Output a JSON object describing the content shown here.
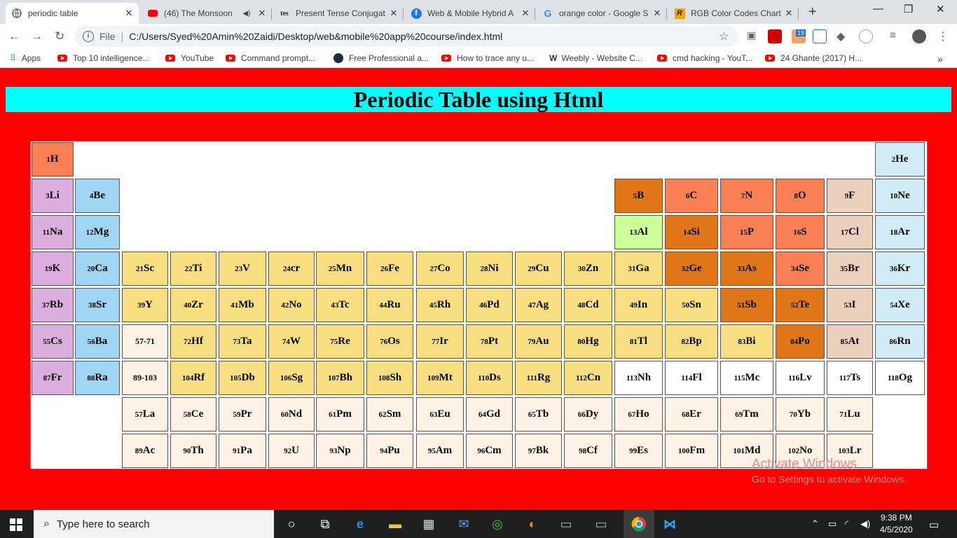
{
  "browser": {
    "tabs": [
      {
        "title": "periodic table",
        "icon": "globe-icon",
        "active": true
      },
      {
        "title": "(46) The Monsoon",
        "icon": "youtube-icon",
        "active": false
      },
      {
        "title": "Present Tense Conjugat",
        "icon": "tes-icon",
        "active": false
      },
      {
        "title": "Web & Mobile Hybrid A",
        "icon": "facebook-icon",
        "active": false
      },
      {
        "title": "orange color - Google S",
        "icon": "google-icon",
        "active": false
      },
      {
        "title": "RGB Color Codes Chart",
        "icon": "rgb-icon",
        "active": false
      }
    ],
    "close_glyph": "✕",
    "new_tab": "+",
    "address": {
      "scheme_label": "File",
      "url": "C:/Users/Syed%20Amin%20Zaidi/Desktop/web&mobile%20app%20course/index.html"
    },
    "bookmarks": [
      {
        "label": "Apps",
        "icon": "apps-grid-icon"
      },
      {
        "label": "Top 10 intelligence...",
        "icon": "youtube-icon"
      },
      {
        "label": "YouTube",
        "icon": "youtube-icon"
      },
      {
        "label": "Command prompt...",
        "icon": "youtube-icon"
      },
      {
        "label": "Free Professional a...",
        "icon": "logo-icon"
      },
      {
        "label": "How to trace any u...",
        "icon": "youtube-icon"
      },
      {
        "label": "Weebly - Website C...",
        "icon": "weebly-icon"
      },
      {
        "label": "cmd hacking - YouT...",
        "icon": "youtube-icon"
      },
      {
        "label": "24 Ghante (2017) H...",
        "icon": "youtube-icon"
      }
    ],
    "bookmarks_more": "»",
    "ext_badge": "19"
  },
  "page": {
    "title": "Periodic Table using Html",
    "colors": {
      "background": "#ff0000",
      "header": "#00ffff",
      "alkali": "#dcaddf",
      "alkaline": "#9fd4f2",
      "transition": "#f7df81",
      "post_transition": "#f7df81",
      "metalloid": "#df7718",
      "nonmetal": "#fa7f55",
      "halogen": "#ebd1bd",
      "noble": "#d1ecf7",
      "lanthanide": "#fdf2e6",
      "unknown": "#ffffff",
      "aluminum": "#ccff99"
    },
    "elements": [
      {
        "n": "1",
        "s": "H",
        "r": 1,
        "c": 1,
        "g": "nonmetal"
      },
      {
        "n": "2",
        "s": "He",
        "r": 1,
        "c": 18,
        "g": "noble"
      },
      {
        "n": "3",
        "s": "Li",
        "r": 2,
        "c": 1,
        "g": "alkali"
      },
      {
        "n": "4",
        "s": "Be",
        "r": 2,
        "c": 2,
        "g": "alkaline"
      },
      {
        "n": "5",
        "s": "B",
        "r": 2,
        "c": 13,
        "g": "metalloid"
      },
      {
        "n": "6",
        "s": "C",
        "r": 2,
        "c": 14,
        "g": "nonmetal"
      },
      {
        "n": "7",
        "s": "N",
        "r": 2,
        "c": 15,
        "g": "nonmetal"
      },
      {
        "n": "8",
        "s": "O",
        "r": 2,
        "c": 16,
        "g": "nonmetal"
      },
      {
        "n": "9",
        "s": "F",
        "r": 2,
        "c": 17,
        "g": "halogen"
      },
      {
        "n": "10",
        "s": "Ne",
        "r": 2,
        "c": 18,
        "g": "noble"
      },
      {
        "n": "11",
        "s": "Na",
        "r": 3,
        "c": 1,
        "g": "alkali"
      },
      {
        "n": "12",
        "s": "Mg",
        "r": 3,
        "c": 2,
        "g": "alkaline"
      },
      {
        "n": "13",
        "s": "Al",
        "r": 3,
        "c": 13,
        "g": "aluminum"
      },
      {
        "n": "14",
        "s": "Si",
        "r": 3,
        "c": 14,
        "g": "metalloid"
      },
      {
        "n": "15",
        "s": "P",
        "r": 3,
        "c": 15,
        "g": "nonmetal"
      },
      {
        "n": "16",
        "s": "S",
        "r": 3,
        "c": 16,
        "g": "nonmetal"
      },
      {
        "n": "17",
        "s": "Cl",
        "r": 3,
        "c": 17,
        "g": "halogen"
      },
      {
        "n": "18",
        "s": "Ar",
        "r": 3,
        "c": 18,
        "g": "noble"
      },
      {
        "n": "19",
        "s": "K",
        "r": 4,
        "c": 1,
        "g": "alkali"
      },
      {
        "n": "20",
        "s": "Ca",
        "r": 4,
        "c": 2,
        "g": "alkaline"
      },
      {
        "n": "21",
        "s": "Sc",
        "r": 4,
        "c": 3,
        "g": "transition"
      },
      {
        "n": "22",
        "s": "Ti",
        "r": 4,
        "c": 4,
        "g": "transition"
      },
      {
        "n": "23",
        "s": "V",
        "r": 4,
        "c": 5,
        "g": "transition"
      },
      {
        "n": "24",
        "s": "cr",
        "r": 4,
        "c": 6,
        "g": "transition"
      },
      {
        "n": "25",
        "s": "Mn",
        "r": 4,
        "c": 7,
        "g": "transition"
      },
      {
        "n": "26",
        "s": "Fe",
        "r": 4,
        "c": 8,
        "g": "transition"
      },
      {
        "n": "27",
        "s": "Co",
        "r": 4,
        "c": 9,
        "g": "transition"
      },
      {
        "n": "28",
        "s": "Ni",
        "r": 4,
        "c": 10,
        "g": "transition"
      },
      {
        "n": "29",
        "s": "Cu",
        "r": 4,
        "c": 11,
        "g": "transition"
      },
      {
        "n": "30",
        "s": "Zn",
        "r": 4,
        "c": 12,
        "g": "transition"
      },
      {
        "n": "31",
        "s": "Ga",
        "r": 4,
        "c": 13,
        "g": "post_transition"
      },
      {
        "n": "32",
        "s": "Ge",
        "r": 4,
        "c": 14,
        "g": "metalloid"
      },
      {
        "n": "33",
        "s": "As",
        "r": 4,
        "c": 15,
        "g": "metalloid"
      },
      {
        "n": "34",
        "s": "Se",
        "r": 4,
        "c": 16,
        "g": "nonmetal"
      },
      {
        "n": "35",
        "s": "Br",
        "r": 4,
        "c": 17,
        "g": "halogen"
      },
      {
        "n": "36",
        "s": "Kr",
        "r": 4,
        "c": 18,
        "g": "noble"
      },
      {
        "n": "37",
        "s": "Rb",
        "r": 5,
        "c": 1,
        "g": "alkali"
      },
      {
        "n": "38",
        "s": "Sr",
        "r": 5,
        "c": 2,
        "g": "alkaline"
      },
      {
        "n": "39",
        "s": "Y",
        "r": 5,
        "c": 3,
        "g": "transition"
      },
      {
        "n": "40",
        "s": "Zr",
        "r": 5,
        "c": 4,
        "g": "transition"
      },
      {
        "n": "41",
        "s": "Mb",
        "r": 5,
        "c": 5,
        "g": "transition"
      },
      {
        "n": "42",
        "s": "No",
        "r": 5,
        "c": 6,
        "g": "transition"
      },
      {
        "n": "43",
        "s": "Tc",
        "r": 5,
        "c": 7,
        "g": "transition"
      },
      {
        "n": "44",
        "s": "Ru",
        "r": 5,
        "c": 8,
        "g": "transition"
      },
      {
        "n": "45",
        "s": "Rh",
        "r": 5,
        "c": 9,
        "g": "transition"
      },
      {
        "n": "46",
        "s": "Pd",
        "r": 5,
        "c": 10,
        "g": "transition"
      },
      {
        "n": "47",
        "s": "Ag",
        "r": 5,
        "c": 11,
        "g": "transition"
      },
      {
        "n": "48",
        "s": "Cd",
        "r": 5,
        "c": 12,
        "g": "transition"
      },
      {
        "n": "49",
        "s": "In",
        "r": 5,
        "c": 13,
        "g": "post_transition"
      },
      {
        "n": "50",
        "s": "Sn",
        "r": 5,
        "c": 14,
        "g": "post_transition"
      },
      {
        "n": "51",
        "s": "Sb",
        "r": 5,
        "c": 15,
        "g": "metalloid"
      },
      {
        "n": "52",
        "s": "Te",
        "r": 5,
        "c": 16,
        "g": "metalloid"
      },
      {
        "n": "53",
        "s": "I",
        "r": 5,
        "c": 17,
        "g": "halogen"
      },
      {
        "n": "54",
        "s": "Xe",
        "r": 5,
        "c": 18,
        "g": "noble"
      },
      {
        "n": "55",
        "s": "Cs",
        "r": 6,
        "c": 1,
        "g": "alkali"
      },
      {
        "n": "56",
        "s": "Ba",
        "r": 6,
        "c": 2,
        "g": "alkaline"
      },
      {
        "n": "",
        "s": "57-71",
        "r": 6,
        "c": 3,
        "g": "lanthanide",
        "label": true
      },
      {
        "n": "72",
        "s": "Hf",
        "r": 6,
        "c": 4,
        "g": "transition"
      },
      {
        "n": "73",
        "s": "Ta",
        "r": 6,
        "c": 5,
        "g": "transition"
      },
      {
        "n": "74",
        "s": "W",
        "r": 6,
        "c": 6,
        "g": "transition"
      },
      {
        "n": "75",
        "s": "Re",
        "r": 6,
        "c": 7,
        "g": "transition"
      },
      {
        "n": "76",
        "s": "Os",
        "r": 6,
        "c": 8,
        "g": "transition"
      },
      {
        "n": "77",
        "s": "Ir",
        "r": 6,
        "c": 9,
        "g": "transition"
      },
      {
        "n": "78",
        "s": "Pt",
        "r": 6,
        "c": 10,
        "g": "transition"
      },
      {
        "n": "79",
        "s": "Au",
        "r": 6,
        "c": 11,
        "g": "transition"
      },
      {
        "n": "80",
        "s": "Hg",
        "r": 6,
        "c": 12,
        "g": "transition"
      },
      {
        "n": "81",
        "s": "Tl",
        "r": 6,
        "c": 13,
        "g": "post_transition"
      },
      {
        "n": "82",
        "s": "Bp",
        "r": 6,
        "c": 14,
        "g": "post_transition"
      },
      {
        "n": "83",
        "s": "Bi",
        "r": 6,
        "c": 15,
        "g": "post_transition"
      },
      {
        "n": "84",
        "s": "Po",
        "r": 6,
        "c": 16,
        "g": "metalloid"
      },
      {
        "n": "85",
        "s": "At",
        "r": 6,
        "c": 17,
        "g": "halogen"
      },
      {
        "n": "86",
        "s": "Rn",
        "r": 6,
        "c": 18,
        "g": "noble"
      },
      {
        "n": "87",
        "s": "Fr",
        "r": 7,
        "c": 1,
        "g": "alkali"
      },
      {
        "n": "88",
        "s": "Ra",
        "r": 7,
        "c": 2,
        "g": "alkaline"
      },
      {
        "n": "",
        "s": "89-103",
        "r": 7,
        "c": 3,
        "g": "lanthanide",
        "label": true
      },
      {
        "n": "104",
        "s": "Rf",
        "r": 7,
        "c": 4,
        "g": "transition"
      },
      {
        "n": "105",
        "s": "Db",
        "r": 7,
        "c": 5,
        "g": "transition"
      },
      {
        "n": "106",
        "s": "Sg",
        "r": 7,
        "c": 6,
        "g": "transition"
      },
      {
        "n": "107",
        "s": "Bh",
        "r": 7,
        "c": 7,
        "g": "transition"
      },
      {
        "n": "108",
        "s": "Sh",
        "r": 7,
        "c": 8,
        "g": "transition"
      },
      {
        "n": "109",
        "s": "Mt",
        "r": 7,
        "c": 9,
        "g": "transition"
      },
      {
        "n": "110",
        "s": "Ds",
        "r": 7,
        "c": 10,
        "g": "transition"
      },
      {
        "n": "111",
        "s": "Rg",
        "r": 7,
        "c": 11,
        "g": "transition"
      },
      {
        "n": "112",
        "s": "Cn",
        "r": 7,
        "c": 12,
        "g": "transition"
      },
      {
        "n": "113",
        "s": "Nh",
        "r": 7,
        "c": 13,
        "g": "unknown"
      },
      {
        "n": "114",
        "s": "Fl",
        "r": 7,
        "c": 14,
        "g": "unknown"
      },
      {
        "n": "115",
        "s": "Mc",
        "r": 7,
        "c": 15,
        "g": "unknown"
      },
      {
        "n": "116",
        "s": "Lv",
        "r": 7,
        "c": 16,
        "g": "unknown"
      },
      {
        "n": "117",
        "s": "Ts",
        "r": 7,
        "c": 17,
        "g": "unknown"
      },
      {
        "n": "118",
        "s": "Og",
        "r": 7,
        "c": 18,
        "g": "unknown"
      },
      {
        "n": "57",
        "s": "La",
        "r": 8,
        "c": 3,
        "g": "lanthanide"
      },
      {
        "n": "58",
        "s": "Ce",
        "r": 8,
        "c": 4,
        "g": "lanthanide"
      },
      {
        "n": "59",
        "s": "Pr",
        "r": 8,
        "c": 5,
        "g": "lanthanide"
      },
      {
        "n": "60",
        "s": "Nd",
        "r": 8,
        "c": 6,
        "g": "lanthanide"
      },
      {
        "n": "61",
        "s": "Pm",
        "r": 8,
        "c": 7,
        "g": "lanthanide"
      },
      {
        "n": "62",
        "s": "Sm",
        "r": 8,
        "c": 8,
        "g": "lanthanide"
      },
      {
        "n": "63",
        "s": "Eu",
        "r": 8,
        "c": 9,
        "g": "lanthanide"
      },
      {
        "n": "64",
        "s": "Gd",
        "r": 8,
        "c": 10,
        "g": "lanthanide"
      },
      {
        "n": "65",
        "s": "Tb",
        "r": 8,
        "c": 11,
        "g": "lanthanide"
      },
      {
        "n": "66",
        "s": "Dy",
        "r": 8,
        "c": 12,
        "g": "lanthanide"
      },
      {
        "n": "67",
        "s": "Ho",
        "r": 8,
        "c": 13,
        "g": "lanthanide"
      },
      {
        "n": "68",
        "s": "Er",
        "r": 8,
        "c": 14,
        "g": "lanthanide"
      },
      {
        "n": "69",
        "s": "Tm",
        "r": 8,
        "c": 15,
        "g": "lanthanide"
      },
      {
        "n": "70",
        "s": "Yb",
        "r": 8,
        "c": 16,
        "g": "lanthanide"
      },
      {
        "n": "71",
        "s": "Lu",
        "r": 8,
        "c": 17,
        "g": "lanthanide"
      },
      {
        "n": "89",
        "s": "Ac",
        "r": 9,
        "c": 3,
        "g": "lanthanide"
      },
      {
        "n": "90",
        "s": "Th",
        "r": 9,
        "c": 4,
        "g": "lanthanide"
      },
      {
        "n": "91",
        "s": "Pa",
        "r": 9,
        "c": 5,
        "g": "lanthanide"
      },
      {
        "n": "92",
        "s": "U",
        "r": 9,
        "c": 6,
        "g": "lanthanide"
      },
      {
        "n": "93",
        "s": "Np",
        "r": 9,
        "c": 7,
        "g": "lanthanide"
      },
      {
        "n": "94",
        "s": "Pu",
        "r": 9,
        "c": 8,
        "g": "lanthanide"
      },
      {
        "n": "95",
        "s": "Am",
        "r": 9,
        "c": 9,
        "g": "lanthanide"
      },
      {
        "n": "96",
        "s": "Cm",
        "r": 9,
        "c": 10,
        "g": "lanthanide"
      },
      {
        "n": "97",
        "s": "Bk",
        "r": 9,
        "c": 11,
        "g": "lanthanide"
      },
      {
        "n": "98",
        "s": "Cf",
        "r": 9,
        "c": 12,
        "g": "lanthanide"
      },
      {
        "n": "99",
        "s": "Es",
        "r": 9,
        "c": 13,
        "g": "lanthanide"
      },
      {
        "n": "100",
        "s": "Fm",
        "r": 9,
        "c": 14,
        "g": "lanthanide"
      },
      {
        "n": "101",
        "s": "Md",
        "r": 9,
        "c": 15,
        "g": "lanthanide"
      },
      {
        "n": "102",
        "s": "No",
        "r": 9,
        "c": 16,
        "g": "lanthanide"
      },
      {
        "n": "103",
        "s": "Lr",
        "r": 9,
        "c": 17,
        "g": "lanthanide"
      }
    ]
  },
  "watermark": {
    "line1": "Activate Windows",
    "line2": "Go to Settings to activate Windows."
  },
  "taskbar": {
    "search_placeholder": "Type here to search",
    "time": "9:38 PM",
    "date": "4/5/2020"
  }
}
